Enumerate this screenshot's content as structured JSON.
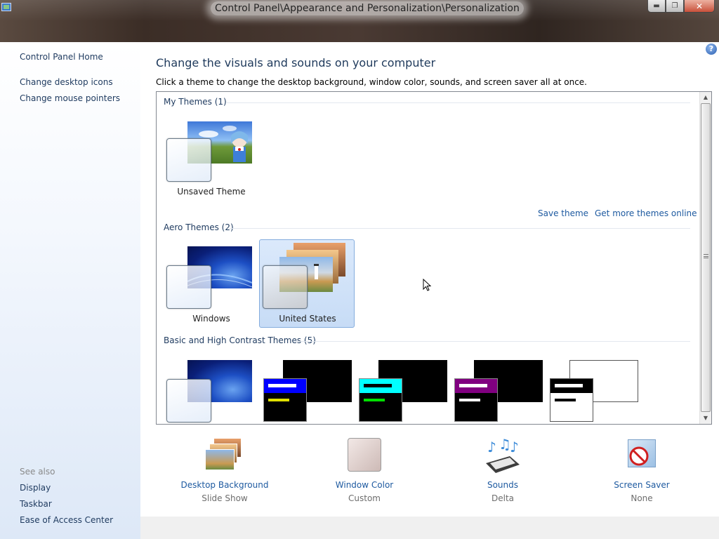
{
  "window": {
    "title": "Control Panel\\Appearance and Personalization\\Personalization",
    "buttons": [
      "minimize",
      "restore",
      "close"
    ]
  },
  "sidebar": {
    "home": "Control Panel Home",
    "links": [
      "Change desktop icons",
      "Change mouse pointers"
    ],
    "see_also_heading": "See also",
    "see_also": [
      "Display",
      "Taskbar",
      "Ease of Access Center"
    ]
  },
  "main": {
    "title": "Change the visuals and sounds on your computer",
    "subtitle": "Click a theme to change the desktop background, window color, sounds, and screen saver all at once.",
    "help": "?",
    "sections": {
      "my_themes": "My Themes (1)",
      "aero": "Aero Themes (2)",
      "basic": "Basic and High Contrast Themes (5)"
    },
    "my_themes": [
      {
        "label": "Unsaved Theme"
      }
    ],
    "aero_themes": [
      {
        "label": "Windows"
      },
      {
        "label": "United States",
        "selected": true
      }
    ],
    "links": {
      "save": "Save theme",
      "more": "Get more themes online"
    }
  },
  "bottom": [
    {
      "label": "Desktop Background",
      "sub": "Slide Show",
      "icon": "desktop-background-icon"
    },
    {
      "label": "Window Color",
      "sub": "Custom",
      "icon": "window-color-icon"
    },
    {
      "label": "Sounds",
      "sub": "Delta",
      "icon": "sounds-icon"
    },
    {
      "label": "Screen Saver",
      "sub": "None",
      "icon": "screen-saver-icon"
    }
  ],
  "colors": {
    "link": "#1e5aa0",
    "heading": "#1e395b",
    "selection": "#c7dcf6",
    "high_contrast_accents": [
      "#0000ff",
      "#00ffff",
      "#800080",
      "#000000"
    ]
  }
}
